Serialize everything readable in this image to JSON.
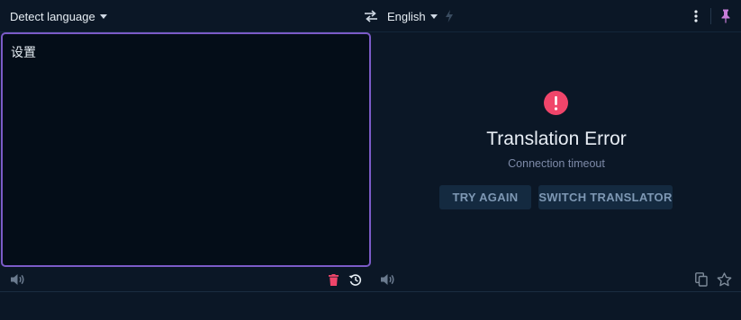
{
  "toolbar": {
    "source_language": "Detect language",
    "target_language": "English",
    "icons": {
      "swap": "swap-arrows-icon",
      "instant": "bolt-icon",
      "more": "more-vertical-icon",
      "pin": "pin-icon"
    },
    "accent_color": "#c77dd8"
  },
  "source": {
    "text": "设置"
  },
  "error": {
    "title": "Translation Error",
    "message": "Connection timeout",
    "retry_label": "TRY AGAIN",
    "switch_label": "SWITCH TRANSLATOR",
    "icon": "exclamation-circle-icon",
    "icon_color": "#f0456a"
  },
  "bottom_bar": {
    "icons": [
      "speaker-icon",
      "delete-icon",
      "history-icon",
      "speaker-icon",
      "copy-icon",
      "star-icon"
    ],
    "delete_color": "#f0456a"
  },
  "colors": {
    "background": "#0b1726",
    "input_background": "#040d18",
    "focus_border": "#7b5bc7"
  }
}
